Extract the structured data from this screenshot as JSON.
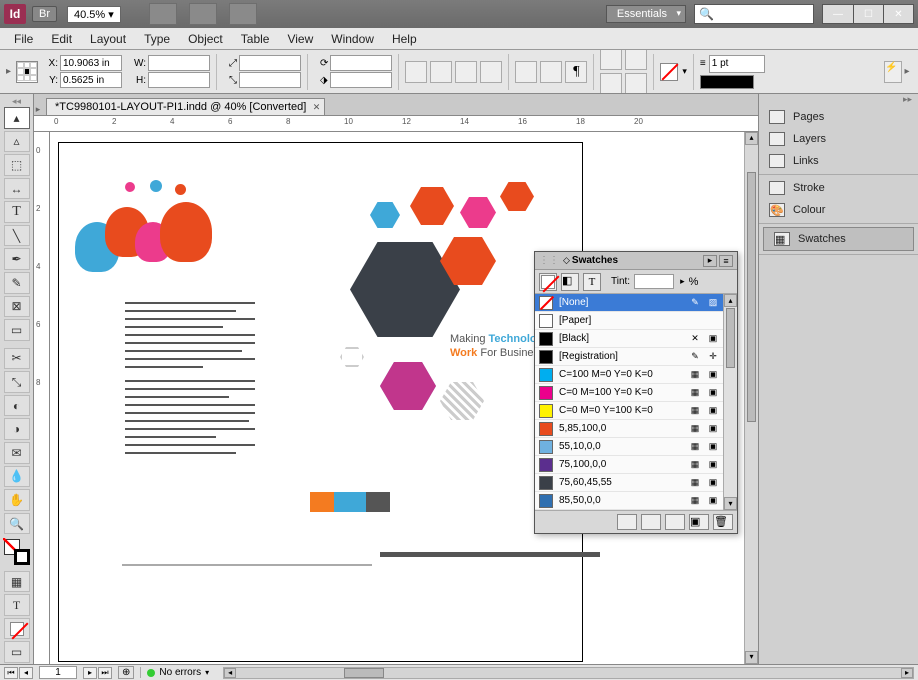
{
  "titlebar": {
    "app": "Id",
    "bridge": "Br",
    "zoom": "40.5%",
    "workspace": "Essentials"
  },
  "menu": [
    "File",
    "Edit",
    "Layout",
    "Type",
    "Object",
    "Table",
    "View",
    "Window",
    "Help"
  ],
  "control": {
    "x": "10.9063 in",
    "y": "0.5625 in",
    "w": "",
    "h": "",
    "stroke_weight": "1 pt"
  },
  "tab": {
    "title": "*TC9980101-LAYOUT-PI1.indd @ 40% [Converted]"
  },
  "hruler": [
    "0",
    "2",
    "4",
    "6",
    "8",
    "10",
    "12",
    "14",
    "16",
    "18",
    "20"
  ],
  "vruler": [
    "0",
    "2",
    "4",
    "6",
    "8"
  ],
  "artwork": {
    "tag1a": "Making ",
    "tag1b": "Technology",
    "tag2a": "Work ",
    "tag2b": "For Business"
  },
  "rightdock": {
    "pages": "Pages",
    "layers": "Layers",
    "links": "Links",
    "stroke": "Stroke",
    "colour": "Colour",
    "swatches": "Swatches"
  },
  "swatches_panel": {
    "title": "Swatches",
    "tint_label": "Tint:",
    "tint_suffix": "%",
    "rows": [
      {
        "name": "[None]",
        "chip": "none",
        "sel": true,
        "i1": "✎",
        "i2": "▨"
      },
      {
        "name": "[Paper]",
        "chip": "#ffffff"
      },
      {
        "name": "[Black]",
        "chip": "#000000",
        "i1": "✕",
        "i2": "▣"
      },
      {
        "name": "[Registration]",
        "chip": "#000000",
        "i1": "✎",
        "i2": "✛"
      },
      {
        "name": "C=100 M=0 Y=0 K=0",
        "chip": "#00aeef",
        "i1": "▦",
        "i2": "▣"
      },
      {
        "name": "C=0 M=100 Y=0 K=0",
        "chip": "#ec008c",
        "i1": "▦",
        "i2": "▣"
      },
      {
        "name": "C=0 M=0 Y=100 K=0",
        "chip": "#fff200",
        "i1": "▦",
        "i2": "▣"
      },
      {
        "name": "5,85,100,0",
        "chip": "#e84b1e",
        "i1": "▦",
        "i2": "▣"
      },
      {
        "name": "55,10,0,0",
        "chip": "#6fb1e0",
        "i1": "▦",
        "i2": "▣"
      },
      {
        "name": "75,100,0,0",
        "chip": "#5b2e8e",
        "i1": "▦",
        "i2": "▣"
      },
      {
        "name": "75,60,45,55",
        "chip": "#3a4048",
        "i1": "▦",
        "i2": "▣"
      },
      {
        "name": "85,50,0,0",
        "chip": "#2f6fb0",
        "i1": "▦",
        "i2": "▣"
      }
    ]
  },
  "status": {
    "page": "1",
    "preflight": "No errors"
  }
}
